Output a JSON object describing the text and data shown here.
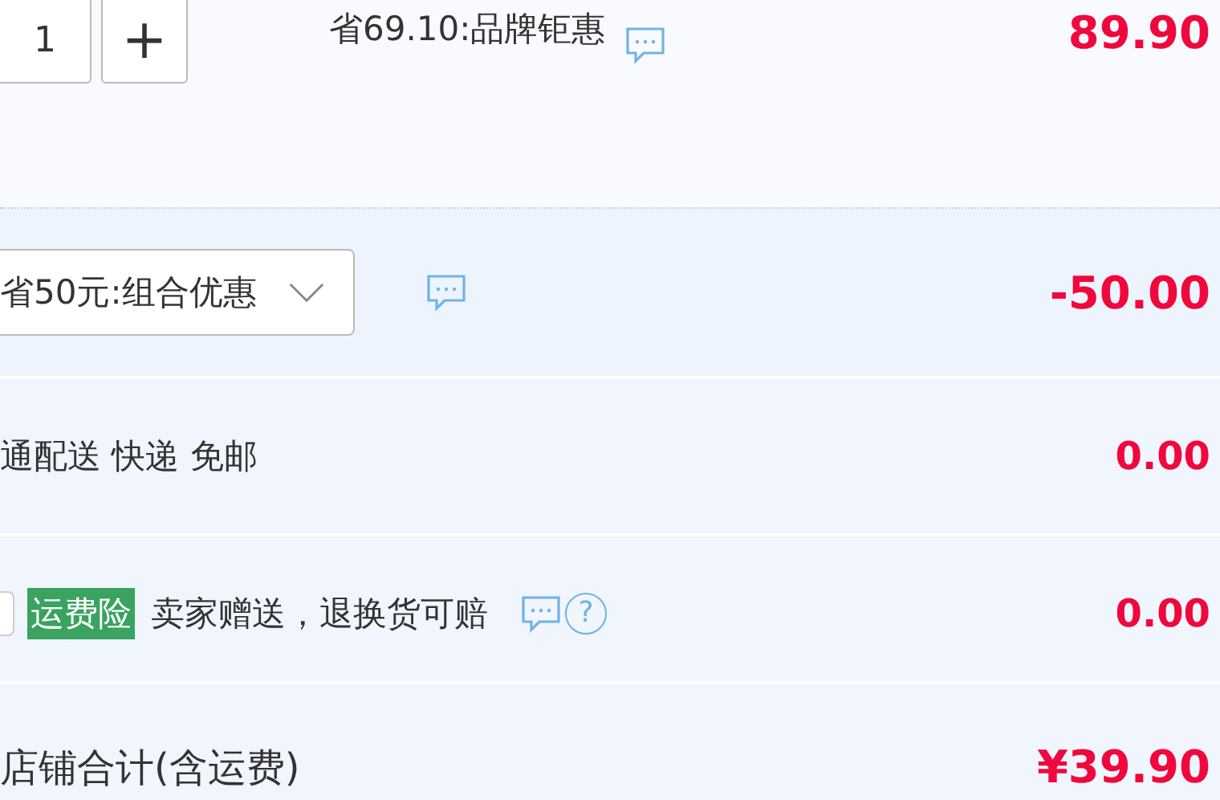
{
  "item": {
    "quantity": "1",
    "plus": "+",
    "promo": "省69.10:品牌钜惠",
    "price": "89.90"
  },
  "combo": {
    "selected_option": "省50元:组合优惠",
    "amount": "-50.00"
  },
  "shipping": {
    "label": "通配送 快递 免邮",
    "amount": "0.00"
  },
  "insurance": {
    "checked": false,
    "tag": "运费险",
    "text": "卖家赠送，退换货可赔",
    "help": "?",
    "amount": "0.00"
  },
  "total": {
    "label": "店铺合计(含运费)",
    "amount": "¥39.90"
  }
}
